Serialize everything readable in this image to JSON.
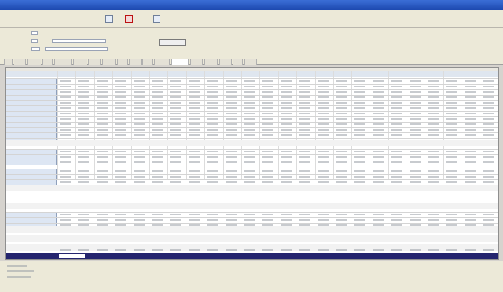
{
  "window": {
    "title": ""
  },
  "menu": {
    "items": [
      "",
      "",
      "",
      "",
      "",
      ""
    ]
  },
  "form": {
    "labels": [
      "",
      "",
      ""
    ],
    "search_button": ""
  },
  "tabs": {
    "count": 18,
    "active_index": 12
  },
  "grid": {
    "section_captions": [
      "",
      "",
      "",
      "",
      "",
      "",
      ""
    ],
    "row_labels": [
      "",
      "",
      "",
      "",
      "",
      "",
      "",
      "",
      "",
      "",
      "",
      "",
      "",
      "",
      "",
      "",
      "",
      "",
      "",
      "",
      ""
    ],
    "selected_row_label": ""
  }
}
